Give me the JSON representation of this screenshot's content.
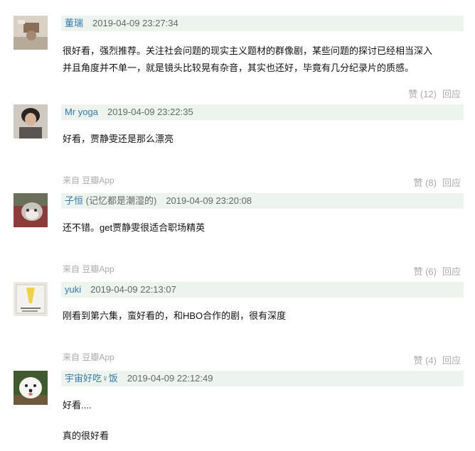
{
  "comments": [
    {
      "user": "董瑞",
      "user_extra": "",
      "time": "2019-04-09 23:27:34",
      "body": [
        "很好看，强烈推荐。关注社会问题的现实主义题材的群像剧，某些问题的探讨已经相当深入",
        "并且角度并不单一，就是镜头比较晃有杂音，其实也还好，毕竟有几分纪录片的质感。"
      ],
      "source": "",
      "votes": "赞 (12)",
      "reply": "回应"
    },
    {
      "user": "Mr yoga",
      "user_extra": "",
      "time": "2019-04-09 23:22:35",
      "body": [
        "好看，贾静雯还是那么漂亮"
      ],
      "source": "来自 豆瓣App",
      "votes": "赞 (8)",
      "reply": "回应"
    },
    {
      "user": "子恒",
      "user_extra": "(记忆都是潮湿的)",
      "time": "2019-04-09 23:20:08",
      "body": [
        "还不错。get贾静雯很适合职场精英"
      ],
      "source": "来自 豆瓣App",
      "votes": "赞 (6)",
      "reply": "回应"
    },
    {
      "user": "yuki",
      "user_extra": "",
      "time": "2019-04-09 22:13:07",
      "body": [
        "刚看到第六集，蛮好看的，和HBO合作的剧，很有深度"
      ],
      "source": "来自 豆瓣App",
      "votes": "赞 (4)",
      "reply": "回应"
    },
    {
      "user": "宇宙好吃♀饭",
      "user_extra": "",
      "time": "2019-04-09 22:12:49",
      "body": [
        "好看....",
        "",
        "真的很好看"
      ],
      "source": "",
      "votes": "",
      "reply": ""
    }
  ],
  "colors": {
    "header_bg": "#edf4ed",
    "username": "#3377aa",
    "meta": "#666666",
    "muted": "#aaaaaa",
    "text": "#111111"
  }
}
